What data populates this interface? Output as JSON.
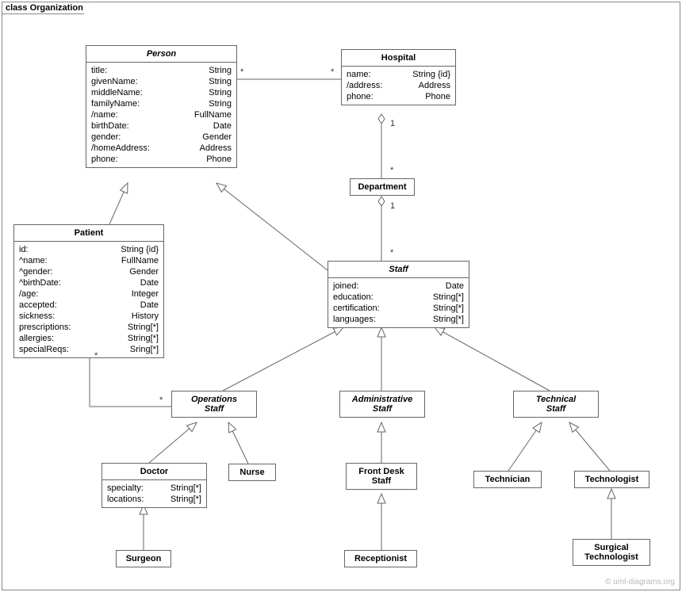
{
  "frame_label": "class Organization",
  "watermark": "© uml-diagrams.org",
  "classes": {
    "person": {
      "name": "Person",
      "attrs": [
        {
          "name": "title:",
          "type": "String"
        },
        {
          "name": "givenName:",
          "type": "String"
        },
        {
          "name": "middleName:",
          "type": "String"
        },
        {
          "name": "familyName:",
          "type": "String"
        },
        {
          "name": "/name:",
          "type": "FullName"
        },
        {
          "name": "birthDate:",
          "type": "Date"
        },
        {
          "name": "gender:",
          "type": "Gender"
        },
        {
          "name": "/homeAddress:",
          "type": "Address"
        },
        {
          "name": "phone:",
          "type": "Phone"
        }
      ]
    },
    "hospital": {
      "name": "Hospital",
      "attrs": [
        {
          "name": "name:",
          "type": "String {id}"
        },
        {
          "name": "/address:",
          "type": "Address"
        },
        {
          "name": "phone:",
          "type": "Phone"
        }
      ]
    },
    "department": {
      "name": "Department"
    },
    "patient": {
      "name": "Patient",
      "attrs": [
        {
          "name": "id:",
          "type": "String {id}"
        },
        {
          "name": "^name:",
          "type": "FullName"
        },
        {
          "name": "^gender:",
          "type": "Gender"
        },
        {
          "name": "^birthDate:",
          "type": "Date"
        },
        {
          "name": "/age:",
          "type": "Integer"
        },
        {
          "name": "accepted:",
          "type": "Date"
        },
        {
          "name": "sickness:",
          "type": "History"
        },
        {
          "name": "prescriptions:",
          "type": "String[*]"
        },
        {
          "name": "allergies:",
          "type": "String[*]"
        },
        {
          "name": "specialReqs:",
          "type": "Sring[*]"
        }
      ]
    },
    "staff": {
      "name": "Staff",
      "attrs": [
        {
          "name": "joined:",
          "type": "Date"
        },
        {
          "name": "education:",
          "type": "String[*]"
        },
        {
          "name": "certification:",
          "type": "String[*]"
        },
        {
          "name": "languages:",
          "type": "String[*]"
        }
      ]
    },
    "operations_staff": {
      "name": "OperationsStaff",
      "display": "Operations\nStaff"
    },
    "administrative_staff": {
      "name": "AdministrativeStaff",
      "display": "Administrative\nStaff"
    },
    "technical_staff": {
      "name": "TechnicalStaff",
      "display": "Technical\nStaff"
    },
    "doctor": {
      "name": "Doctor",
      "attrs": [
        {
          "name": "specialty:",
          "type": "String[*]"
        },
        {
          "name": "locations:",
          "type": "String[*]"
        }
      ]
    },
    "nurse": {
      "name": "Nurse"
    },
    "front_desk_staff": {
      "name": "FrontDeskStaff",
      "display": "Front Desk\nStaff"
    },
    "receptionist": {
      "name": "Receptionist"
    },
    "technician": {
      "name": "Technician"
    },
    "technologist": {
      "name": "Technologist"
    },
    "surgical_technologist": {
      "name": "SurgicalTechnologist",
      "display": "Surgical\nTechnologist"
    },
    "surgeon": {
      "name": "Surgeon"
    }
  },
  "mult": {
    "person_hosp_l": "*",
    "person_hosp_r": "*",
    "hosp_dept_t": "1",
    "hosp_dept_b": "*",
    "dept_staff_t": "1",
    "dept_staff_b": "*",
    "patient_ops_l": "*",
    "patient_ops_r": "*"
  }
}
